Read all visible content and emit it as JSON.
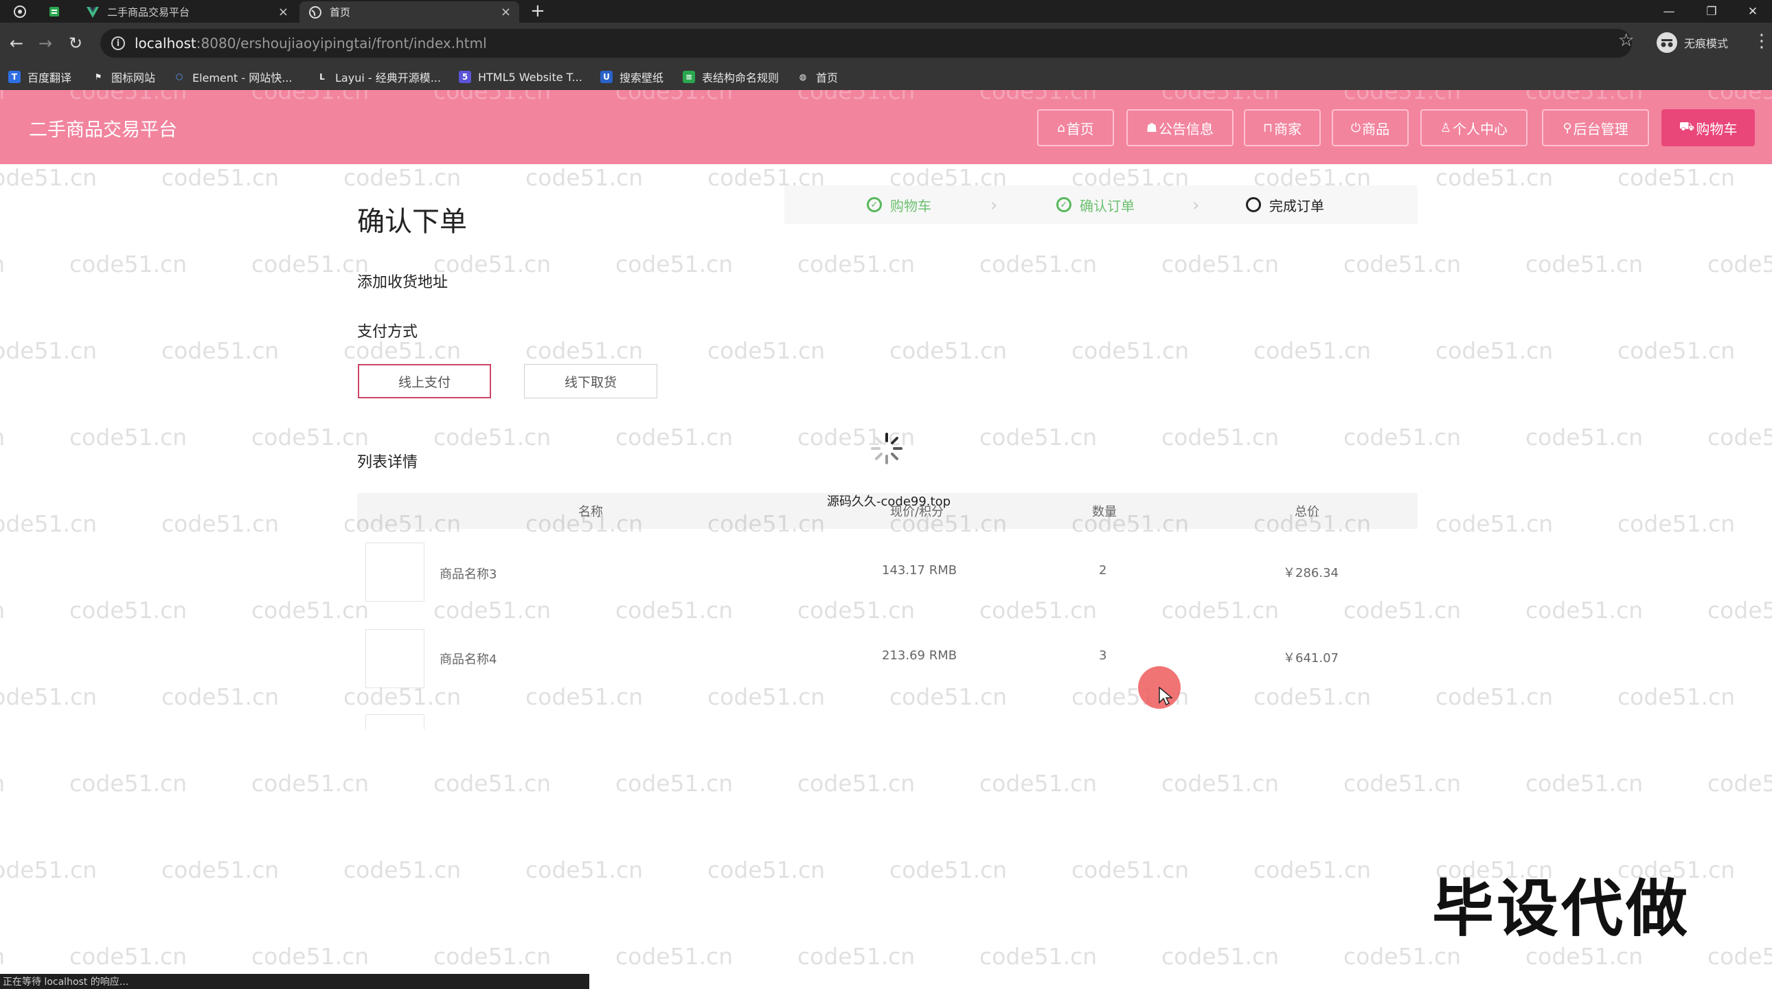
{
  "browser": {
    "tabs": [
      {
        "title": "二手商品交易平台",
        "active": false
      },
      {
        "title": "首页",
        "active": true
      }
    ],
    "url_host": "localhost",
    "url_path": ":8080/ershoujiaoyipingtai/front/index.html",
    "incognito_label": "无痕模式",
    "bookmarks": [
      "百度翻译",
      "图标网站",
      "Element - 网站快...",
      "Layui - 经典开源模...",
      "HTML5 Website T...",
      "搜索壁纸",
      "表结构命名规则",
      "首页"
    ],
    "status_text": "正在等待 localhost 的响应..."
  },
  "header": {
    "site_title": "二手商品交易平台",
    "nav": [
      {
        "icon": "home-icon",
        "glyph": "⌂",
        "label": "首页"
      },
      {
        "icon": "notice-icon",
        "glyph": "☗",
        "label": "公告信息"
      },
      {
        "icon": "shop-icon",
        "glyph": "⊓",
        "label": "商家"
      },
      {
        "icon": "power-icon",
        "glyph": "⏻",
        "label": "商品"
      },
      {
        "icon": "user-icon",
        "glyph": "♙",
        "label": "个人中心"
      },
      {
        "icon": "link-icon",
        "glyph": "⚲",
        "label": "后台管理"
      },
      {
        "icon": "cart-icon",
        "glyph": "⛟",
        "label": "购物车"
      }
    ]
  },
  "page": {
    "title": "确认下单",
    "steps": [
      {
        "label": "购物车",
        "status": "done"
      },
      {
        "label": "确认订单",
        "status": "done"
      },
      {
        "label": "完成订单",
        "status": "todo"
      }
    ],
    "address_label": "添加收货地址",
    "payment_label": "支付方式",
    "payment_options": [
      {
        "label": "线上支付",
        "selected": true
      },
      {
        "label": "线下取货",
        "selected": false
      }
    ],
    "list_label": "列表详情",
    "table_headers": [
      "名称",
      "现价/积分",
      "数量",
      "总价"
    ],
    "rows": [
      {
        "name": "商品名称3",
        "price": "143.17 RMB",
        "qty": "2",
        "total": "￥286.34"
      },
      {
        "name": "商品名称4",
        "price": "213.69 RMB",
        "qty": "3",
        "total": "￥641.07"
      }
    ]
  },
  "overlays": {
    "watermark_text": "code51.cn",
    "source_note": "源码久久-code99.top",
    "banner_text": "毕设代做"
  },
  "colors": {
    "header_bg": "#f2849e",
    "active_nav": "#e9467a",
    "step_done": "#6cc070",
    "selected_border": "#cc4466"
  }
}
